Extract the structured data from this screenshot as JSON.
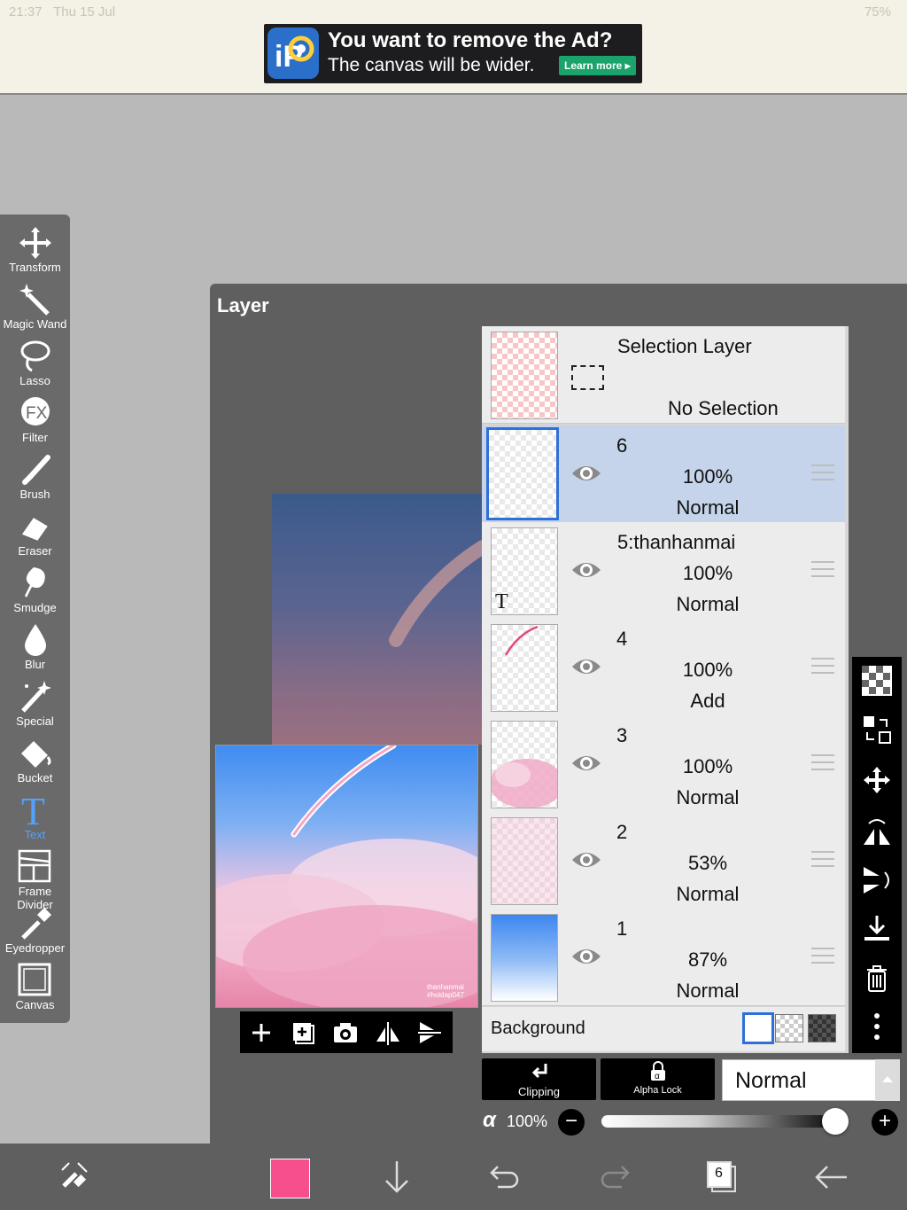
{
  "status": {
    "time": "21:37",
    "date": "Thu 15 Jul",
    "battery": "75%"
  },
  "ad": {
    "headline": "You want to remove the Ad?",
    "sub": "The canvas will be wider.",
    "cta": "Learn more ▸"
  },
  "toolbar": {
    "items": [
      {
        "label": "Transform",
        "icon": "transform-icon"
      },
      {
        "label": "Magic Wand",
        "icon": "magic-wand-icon"
      },
      {
        "label": "Lasso",
        "icon": "lasso-icon"
      },
      {
        "label": "Filter",
        "icon": "fx-icon"
      },
      {
        "label": "Brush",
        "icon": "brush-icon"
      },
      {
        "label": "Eraser",
        "icon": "eraser-icon"
      },
      {
        "label": "Smudge",
        "icon": "smudge-icon"
      },
      {
        "label": "Blur",
        "icon": "blur-drop-icon"
      },
      {
        "label": "Special",
        "icon": "special-wand-icon"
      },
      {
        "label": "Bucket",
        "icon": "bucket-icon"
      },
      {
        "label": "Text",
        "icon": "text-icon",
        "active": true
      },
      {
        "label": "Frame Divider",
        "icon": "frame-divider-icon"
      },
      {
        "label": "Eyedropper",
        "icon": "eyedropper-icon"
      },
      {
        "label": "Canvas",
        "icon": "canvas-icon"
      }
    ]
  },
  "panel": {
    "title": "Layer",
    "signature": "thanhanmai\n#hoidap047"
  },
  "selection_layer": {
    "title": "Selection Layer",
    "status": "No Selection"
  },
  "layers": [
    {
      "name": "6",
      "opacity": "100%",
      "mode": "Normal",
      "selected": true
    },
    {
      "name": "5:thanhanmai",
      "opacity": "100%",
      "mode": "Normal",
      "thumb_glyph": "T"
    },
    {
      "name": "4",
      "opacity": "100%",
      "mode": "Add"
    },
    {
      "name": "3",
      "opacity": "100%",
      "mode": "Normal"
    },
    {
      "name": "2",
      "opacity": "53%",
      "mode": "Normal"
    },
    {
      "name": "1",
      "opacity": "87%",
      "mode": "Normal"
    }
  ],
  "background": {
    "label": "Background"
  },
  "bottom_controls": {
    "clipping": "Clipping",
    "alpha_lock": "Alpha Lock",
    "blend_mode": "Normal",
    "alpha_symbol": "α",
    "alpha_value": "100%",
    "alpha_fraction": 1.0,
    "minus": "−",
    "plus": "+"
  },
  "bottombar": {
    "color": "#f74f8e",
    "layer_count": "6"
  }
}
